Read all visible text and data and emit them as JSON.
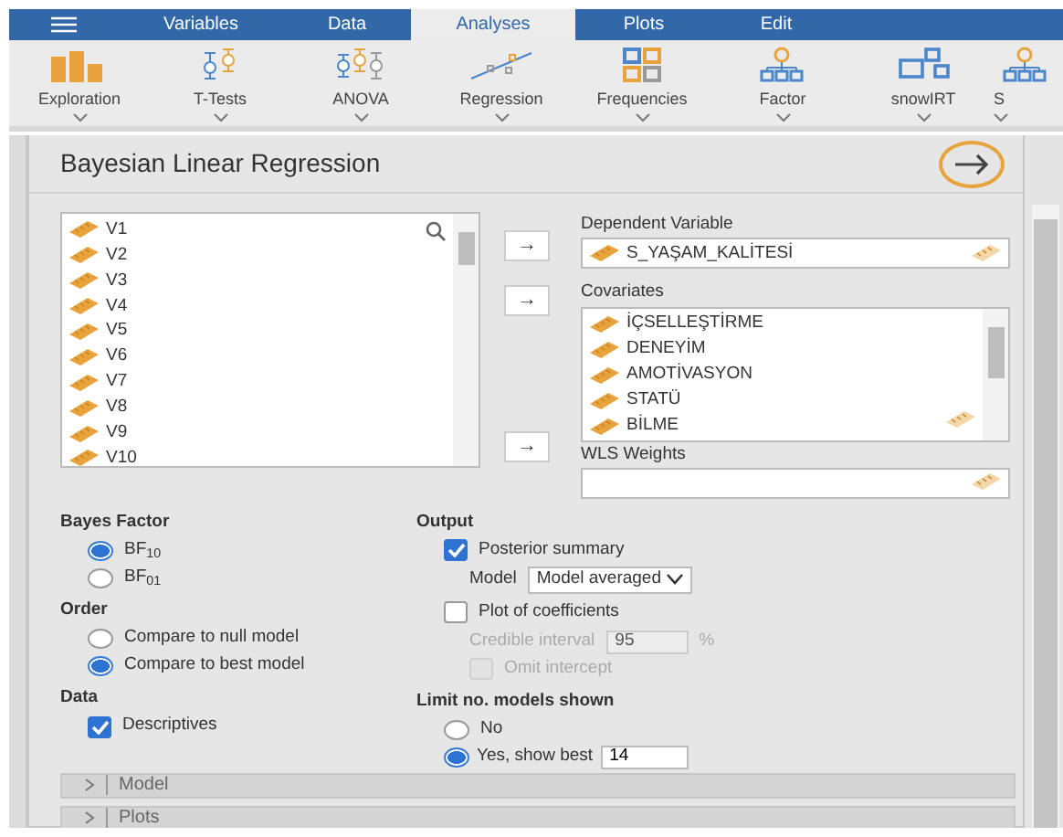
{
  "menu": {
    "tabs": [
      {
        "label": "Variables",
        "selected": false
      },
      {
        "label": "Data",
        "selected": false
      },
      {
        "label": "Analyses",
        "selected": true
      },
      {
        "label": "Plots",
        "selected": false
      },
      {
        "label": "Edit",
        "selected": false
      }
    ]
  },
  "toolbar": [
    {
      "label": "Exploration",
      "kind": "bars"
    },
    {
      "label": "T-Tests",
      "kind": "ttest"
    },
    {
      "label": "ANOVA",
      "kind": "anova"
    },
    {
      "label": "Regression",
      "kind": "regression"
    },
    {
      "label": "Frequencies",
      "kind": "grid"
    },
    {
      "label": "Factor",
      "kind": "tree"
    },
    {
      "label": "snowIRT",
      "kind": "irt"
    },
    {
      "label": "S",
      "kind": "tree"
    }
  ],
  "analysis": {
    "title": "Bayesian Linear Regression"
  },
  "variables": [
    "V1",
    "V2",
    "V3",
    "V4",
    "V5",
    "V6",
    "V7",
    "V8",
    "V9",
    "V10"
  ],
  "arrow_buttons": [
    "→",
    "→",
    "→"
  ],
  "dependent_variable": {
    "label": "Dependent Variable",
    "value": "S_YAŞAM_KALİTESİ"
  },
  "covariates": {
    "label": "Covariates",
    "items": [
      "İÇSELLEŞTİRME",
      "DENEYİM",
      "AMOTİVASYON",
      "STATÜ",
      "BİLME"
    ]
  },
  "wls_weights": {
    "label": "WLS Weights"
  },
  "bayes_factor": {
    "heading": "Bayes Factor",
    "options": [
      {
        "label": "BF$_{10}$",
        "selected": true
      },
      {
        "label": "BF$_{01}$",
        "selected": false
      }
    ]
  },
  "order": {
    "heading": "Order",
    "options": [
      {
        "label": "Compare to null model",
        "selected": false
      },
      {
        "label": "Compare to best model",
        "selected": true
      }
    ]
  },
  "data": {
    "heading": "Data",
    "options": [
      {
        "label": "Descriptives",
        "checked": true
      }
    ]
  },
  "output": {
    "heading": "Output",
    "posterior_summary": {
      "label": "Posterior summary",
      "checked": true
    },
    "model": {
      "label": "Model",
      "value": "Model averaged"
    },
    "plot_of_coefficients": {
      "label": "Plot of coefficients",
      "checked": false
    },
    "credible_interval": {
      "label": "Credible interval",
      "value": "95",
      "unit": "%",
      "disabled": true
    },
    "omit_intercept": {
      "label": "Omit intercept",
      "checked": false,
      "disabled": true
    }
  },
  "limit_models": {
    "heading": "Limit no. models shown",
    "options": [
      {
        "label": "No",
        "selected": false
      },
      {
        "label": "Yes, show best",
        "selected": true,
        "value": "14"
      }
    ]
  },
  "sections": [
    {
      "label": "Model",
      "expanded": false
    },
    {
      "label": "Plots",
      "expanded": false
    }
  ]
}
